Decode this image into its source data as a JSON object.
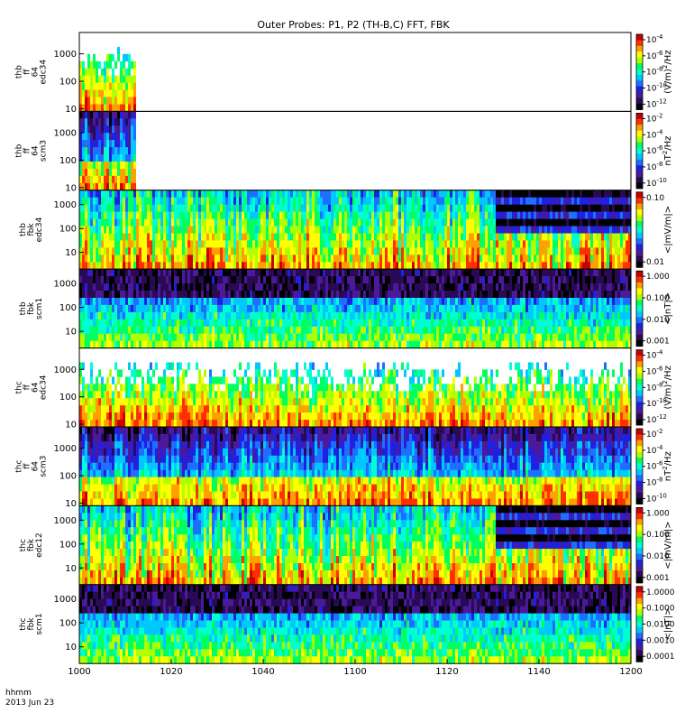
{
  "chart_data": {
    "type": "heatmap",
    "title": "Outer Probes: P1, P2 (TH-B,C) FFT, FBK",
    "x_axis": {
      "tick_labels": [
        "1000",
        "1020",
        "1040",
        "1100",
        "1120",
        "1140",
        "1200"
      ],
      "minutes_range": [
        0,
        120
      ],
      "label_line1": "hhmm",
      "label_line2": "2013 Jun 23"
    },
    "panels": [
      {
        "label": [
          "thb",
          "ff",
          "64",
          "edc34"
        ],
        "y_ticks": [
          "1000",
          "100",
          "10"
        ],
        "ylim_hz": [
          8,
          6000
        ],
        "cb_ticks": [
          "10^-4",
          "10^-6",
          "10^-8",
          "10^-10",
          "10^-12"
        ],
        "cb_unit": "(V/m)^2/Hz",
        "data_extent_min": 12,
        "kind": "ff_e"
      },
      {
        "label": [
          "thb",
          "ff",
          "64",
          "scm3"
        ],
        "y_ticks": [
          "1000",
          "100",
          "10"
        ],
        "ylim_hz": [
          8,
          6000
        ],
        "cb_ticks": [
          "10^-2",
          "10^-4",
          "10^-6",
          "10^-8",
          "10^-10"
        ],
        "cb_unit": "nT^2/Hz",
        "data_extent_min": 12,
        "kind": "ff_b"
      },
      {
        "label": [
          "thb",
          "fbk",
          "edc34"
        ],
        "y_ticks": [
          "1000",
          "100",
          "10"
        ],
        "ylim_hz": [
          2,
          4000
        ],
        "cb_ticks": [
          "0.10",
          "0.01"
        ],
        "cb_unit": "<|mV/m|>",
        "data_extent_min": 120,
        "kind": "fbk_e"
      },
      {
        "label": [
          "thb",
          "fbk",
          "scm1"
        ],
        "y_ticks": [
          "1000",
          "100",
          "10"
        ],
        "ylim_hz": [
          2,
          4000
        ],
        "cb_ticks": [
          "1.000",
          "0.100",
          "0.010",
          "0.001"
        ],
        "cb_unit": "<|nT|>",
        "data_extent_min": 120,
        "kind": "fbk_b"
      },
      {
        "label": [
          "thc",
          "ff",
          "64",
          "edc34"
        ],
        "y_ticks": [
          "1000",
          "100",
          "10"
        ],
        "ylim_hz": [
          8,
          6000
        ],
        "cb_ticks": [
          "10^-4",
          "10^-6",
          "10^-8",
          "10^-10",
          "10^-12"
        ],
        "cb_unit": "(V/m)^2/Hz",
        "data_extent_min": 120,
        "kind": "ff_e"
      },
      {
        "label": [
          "thc",
          "ff",
          "64",
          "scm3"
        ],
        "y_ticks": [
          "1000",
          "100",
          "10"
        ],
        "ylim_hz": [
          8,
          6000
        ],
        "cb_ticks": [
          "10^-2",
          "10^-4",
          "10^-6",
          "10^-8",
          "10^-10"
        ],
        "cb_unit": "nT^2/Hz",
        "data_extent_min": 120,
        "kind": "ff_b"
      },
      {
        "label": [
          "thc",
          "fbk",
          "edc12"
        ],
        "y_ticks": [
          "1000",
          "100",
          "10"
        ],
        "ylim_hz": [
          2,
          4000
        ],
        "cb_ticks": [
          "1.000",
          "0.100",
          "0.010",
          "0.001"
        ],
        "cb_unit": "<|mV/m|>",
        "data_extent_min": 120,
        "kind": "fbk_e"
      },
      {
        "label": [
          "thc",
          "fbk",
          "scm1"
        ],
        "y_ticks": [
          "1000",
          "100",
          "10"
        ],
        "ylim_hz": [
          2,
          4000
        ],
        "cb_ticks": [
          "1.0000",
          "0.1000",
          "0.0100",
          "0.0010",
          "0.0001"
        ],
        "cb_unit": "<|nT|>",
        "data_extent_min": 120,
        "kind": "fbk_b"
      }
    ],
    "colormap": [
      "#000000",
      "#2a0a55",
      "#4b1a9a",
      "#2020e0",
      "#1e6fff",
      "#00c8ff",
      "#00ffd0",
      "#00ff60",
      "#b0ff00",
      "#ffff00",
      "#ffa000",
      "#ff3000",
      "#c80000"
    ]
  }
}
